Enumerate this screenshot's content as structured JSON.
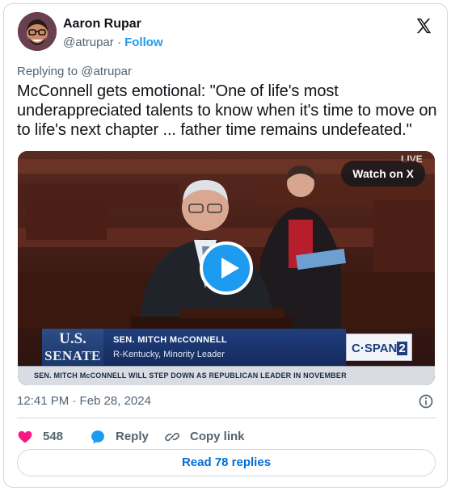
{
  "author": {
    "name": "Aaron Rupar",
    "handle": "@atrupar",
    "separator": "·",
    "follow_label": "Follow"
  },
  "reply_context": {
    "prefix": "Replying to",
    "handle": "@atrupar"
  },
  "tweet": {
    "text": "McConnell gets emotional: \"One of life's most underappreciated talents to know when it's time to move on to life's next chapter ... father time remains undefeated.\"",
    "timestamp": "12:41 PM · Feb 28, 2024"
  },
  "media": {
    "watch_label": "Watch on X",
    "live_bug": "LIVE",
    "chyron": {
      "logo_us": "U.S.",
      "logo_senate": "SENATE",
      "name": "SEN. MITCH McCONNELL",
      "role": "R-Kentucky, Minority Leader",
      "network": "C·SPAN",
      "network_num": "2",
      "ticker": "SEN. MITCH McCONNELL WILL STEP DOWN AS REPUBLICAN LEADER IN NOVEMBER"
    }
  },
  "actions": {
    "like_count": "548",
    "reply_label": "Reply",
    "copy_label": "Copy link"
  },
  "read_replies_label": "Read 78 replies",
  "icons": {
    "heart": "heart-icon",
    "reply": "speech-bubble-icon",
    "link": "link-icon",
    "info": "info-icon",
    "brand": "x-logo-icon",
    "play": "play-icon"
  },
  "colors": {
    "accent": "#1d9bf0",
    "link": "#006fd6",
    "like": "#f91880",
    "muted": "#536471",
    "text": "#0f1419",
    "border": "#cfd9de"
  }
}
